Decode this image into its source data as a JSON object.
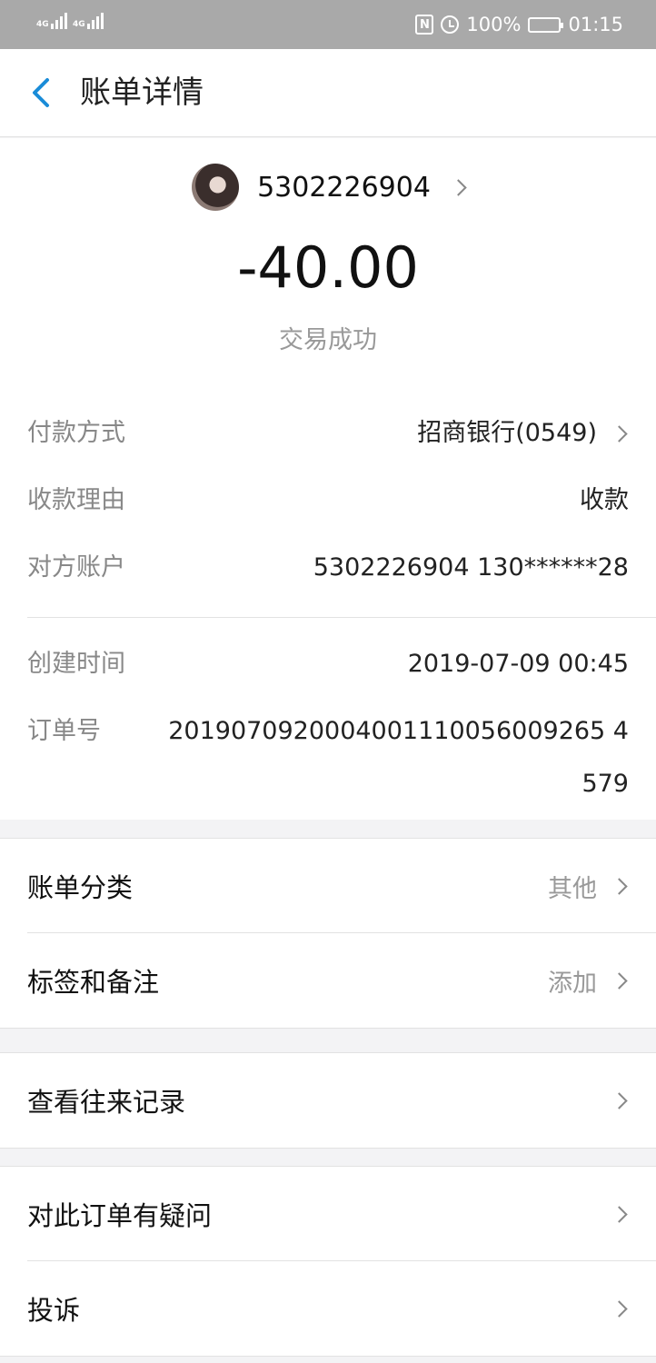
{
  "status_bar": {
    "network1": "4G",
    "network2": "4G",
    "nfc": "N",
    "battery_percent": "100%",
    "time": "01:15"
  },
  "header": {
    "title": "账单详情",
    "back_icon": "chevron-left-icon",
    "accent_color": "#1a8cd8"
  },
  "payee": {
    "name": "5302226904",
    "avatar_icon": "user-avatar"
  },
  "amount": "-40.00",
  "status": "交易成功",
  "details": {
    "payment_method_label": "付款方式",
    "payment_method_value": "招商银行(0549)",
    "reason_label": "收款理由",
    "reason_value": "收款",
    "counterparty_label": "对方账户",
    "counterparty_value": "5302226904 130******28",
    "created_label": "创建时间",
    "created_value": "2019-07-09 00:45",
    "order_label": "订单号",
    "order_value": "2019070920004001110056009265 4579"
  },
  "section1": {
    "category_label": "账单分类",
    "category_value": "其他",
    "tags_label": "标签和备注",
    "tags_value": "添加"
  },
  "section2": {
    "history_label": "查看往来记录"
  },
  "section3": {
    "question_label": "对此订单有疑问",
    "complaint_label": "投诉"
  }
}
